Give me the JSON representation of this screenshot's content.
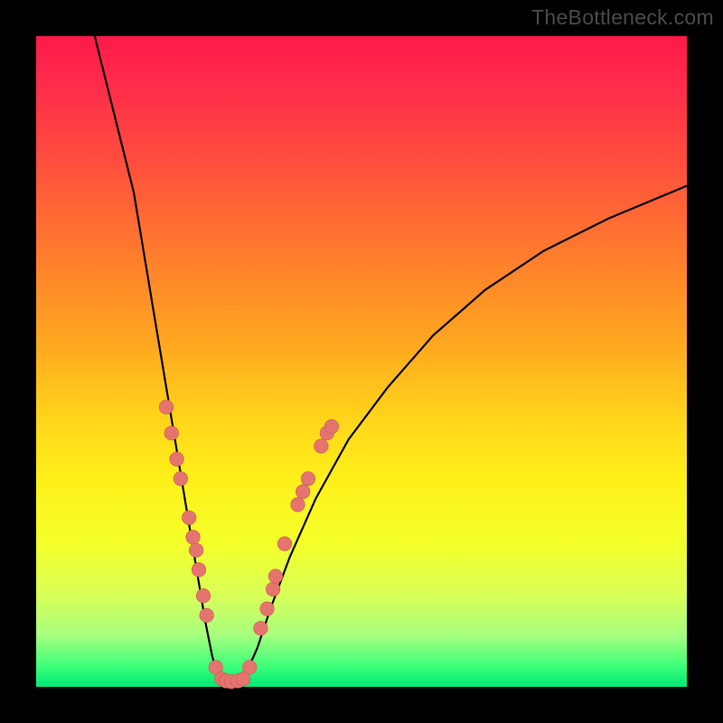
{
  "watermark": "TheBottleneck.com",
  "chart_data": {
    "type": "line",
    "title": "",
    "xlabel": "",
    "ylabel": "",
    "xlim": [
      0,
      100
    ],
    "ylim": [
      0,
      100
    ],
    "grid": false,
    "series": [
      {
        "name": "left-branch",
        "x": [
          9,
          11,
          13,
          15,
          16,
          17,
          18,
          19,
          20,
          21,
          22,
          23,
          24,
          25,
          26,
          27,
          28
        ],
        "y": [
          100,
          92,
          84,
          76,
          70,
          64,
          58,
          52,
          46,
          40,
          34,
          28,
          22,
          16,
          10,
          5,
          1
        ]
      },
      {
        "name": "valley-floor",
        "x": [
          28,
          29,
          30,
          31,
          32
        ],
        "y": [
          1,
          0.5,
          0.4,
          0.5,
          1
        ]
      },
      {
        "name": "right-branch",
        "x": [
          32,
          34,
          36,
          39,
          43,
          48,
          54,
          61,
          69,
          78,
          88,
          100
        ],
        "y": [
          1.5,
          6,
          12,
          20,
          29,
          38,
          46,
          54,
          61,
          67,
          72,
          77
        ]
      }
    ],
    "markers": {
      "name": "highlight-points",
      "color": "#e6746e",
      "points": [
        {
          "x": 20.0,
          "y": 43
        },
        {
          "x": 20.8,
          "y": 39
        },
        {
          "x": 21.6,
          "y": 35
        },
        {
          "x": 22.2,
          "y": 32
        },
        {
          "x": 23.5,
          "y": 26
        },
        {
          "x": 24.1,
          "y": 23
        },
        {
          "x": 24.6,
          "y": 21
        },
        {
          "x": 25.0,
          "y": 18
        },
        {
          "x": 25.7,
          "y": 14
        },
        {
          "x": 26.2,
          "y": 11
        },
        {
          "x": 27.6,
          "y": 3
        },
        {
          "x": 28.5,
          "y": 1.2
        },
        {
          "x": 29.2,
          "y": 0.9
        },
        {
          "x": 30.0,
          "y": 0.8
        },
        {
          "x": 31.0,
          "y": 0.9
        },
        {
          "x": 31.8,
          "y": 1.2
        },
        {
          "x": 32.8,
          "y": 3
        },
        {
          "x": 34.5,
          "y": 9
        },
        {
          "x": 35.5,
          "y": 12
        },
        {
          "x": 36.4,
          "y": 15
        },
        {
          "x": 36.8,
          "y": 17
        },
        {
          "x": 38.2,
          "y": 22
        },
        {
          "x": 40.2,
          "y": 28
        },
        {
          "x": 41.0,
          "y": 30
        },
        {
          "x": 41.8,
          "y": 32
        },
        {
          "x": 43.8,
          "y": 37
        },
        {
          "x": 44.7,
          "y": 39
        },
        {
          "x": 45.4,
          "y": 40
        }
      ]
    },
    "background_gradient": {
      "top": "#ff1a4b",
      "mid": "#ffd21a",
      "bottom": "#00e874"
    }
  }
}
